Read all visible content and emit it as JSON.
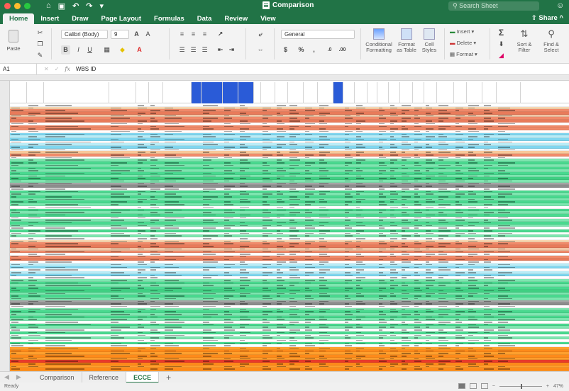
{
  "window": {
    "title": "Comparison",
    "search_placeholder": "Search Sheet",
    "share_label": "Share"
  },
  "tabs": [
    "Home",
    "Insert",
    "Draw",
    "Page Layout",
    "Formulas",
    "Data",
    "Review",
    "View"
  ],
  "ribbon": {
    "paste_label": "Paste",
    "font_name": "Calibri (Body)",
    "font_size": "9",
    "number_format": "General",
    "conditional_formatting": "Conditional Formatting",
    "format_as_table": "Format as Table",
    "cell_styles": "Cell Styles",
    "insert": "Insert",
    "delete": "Delete",
    "format": "Format",
    "sort_filter": "Sort & Filter",
    "find_select": "Find & Select"
  },
  "formula_bar": {
    "cell_ref": "A1",
    "fx": "fx",
    "value": "WBS ID"
  },
  "sheets": [
    "Comparison",
    "Reference",
    "ECCE"
  ],
  "active_sheet": "ECCE",
  "status": {
    "ready": "Ready",
    "zoom": "47%"
  },
  "row_colors": [
    "#ffffff",
    "#f8d6b0",
    "#f08a6a",
    "#e87a5a",
    "#f2c6a6",
    "#f08a6a",
    "#e87a5a",
    "#ffffff",
    "#f08a6a",
    "#f08a6a",
    "#ffffff",
    "#7fd6ef",
    "#b8ecf7",
    "#7fd6ef",
    "#ffffff",
    "#b8ecf7",
    "#7fd6ef",
    "#ffffff",
    "#f8c89a",
    "#f08a6a",
    "#ffffff",
    "#7ee6b0",
    "#49d98f",
    "#7ee6b0",
    "#49d98f",
    "#7ee6b0",
    "#49d98f",
    "#7ee6b0",
    "#3fcf82",
    "#7ee6b0",
    "#a5a5a5",
    "#8c8c8c",
    "#ffffff",
    "#49d98f",
    "#7ee6b0",
    "#49d98f",
    "#7ee6b0",
    "#49d98f",
    "#7ee6b0",
    "#ffffff",
    "#49d98f",
    "#7ee6b0",
    "#49d98f",
    "#ffffff",
    "#7ee6b0",
    "#49d98f",
    "#7ee6b0",
    "#ffffff",
    "#49d98f",
    "#ffffff",
    "#7ee6b0",
    "#ffffff",
    "#f8d6b0",
    "#f08a6a",
    "#e87a5a",
    "#f2c6a6",
    "#f08a6a",
    "#ffffff",
    "#f08a6a",
    "#e87a5a",
    "#ffffff",
    "#b8ecf7",
    "#7fd6ef",
    "#ffffff",
    "#b8ecf7",
    "#7fd6ef",
    "#ffffff",
    "#7ee6b0",
    "#49d98f",
    "#7ee6b0",
    "#49d98f",
    "#3fcf82",
    "#7ee6b0",
    "#49d98f",
    "#7ee6b0",
    "#a5a5a5",
    "#8c8c8c",
    "#ffffff",
    "#7ee6b0",
    "#49d98f",
    "#7ee6b0",
    "#49d98f",
    "#7ee6b0",
    "#ffffff",
    "#49d98f",
    "#7ee6b0",
    "#ffffff",
    "#49d98f",
    "#ffffff",
    "#7ee6b0",
    "#ffffff",
    "#49d98f",
    "#ffffff",
    "#ff9f2e",
    "#ff8a1a",
    "#ff9f2e",
    "#ff8a1a",
    "#ff9f2e",
    "#e83a2a",
    "#ff8a1a",
    "#ff9f2e",
    "#ff8a1a",
    "#ff9f2e",
    "#2a5bd7",
    "#6aa0ff",
    "#ff8a1a"
  ]
}
